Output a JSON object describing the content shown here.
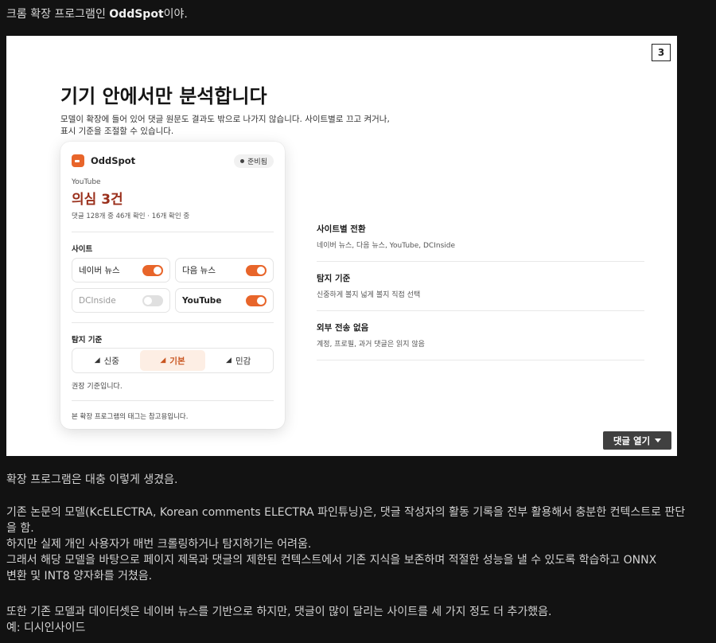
{
  "post": {
    "intro_before": "크롬 확장 프로그램인 ",
    "intro_bold": "OddSpot",
    "intro_after": "이야."
  },
  "slide": {
    "page_number": "3",
    "title": "기기 안에서만 분석합니다",
    "desc_line1": "모델이 확장에 들어 있어 댓글 원문도 결과도 밖으로 나가지 않습니다. 사이트별로 끄고 켜거나,",
    "desc_line2": "표시 기준을 조절할 수 있습니다.",
    "comment_button": "댓글 열기"
  },
  "card": {
    "brand": "OddSpot",
    "status": "준비됨",
    "site": "YouTube",
    "count": "의심 3건",
    "sub": "댓글 128개 중 46개 확인 · 16개 확인 중",
    "sites_label": "사이트",
    "sites": [
      {
        "label": "네이버 뉴스",
        "on": true
      },
      {
        "label": "다음 뉴스",
        "on": true
      },
      {
        "label": "DCInside",
        "on": false
      },
      {
        "label": "YouTube",
        "on": true
      }
    ],
    "criteria_label": "탐지 기준",
    "criteria": [
      {
        "label": "신중",
        "active": false
      },
      {
        "label": "기본",
        "active": true
      },
      {
        "label": "민감",
        "active": false
      }
    ],
    "hint": "권장 기준입니다.",
    "footer": "본 확장 프로그램의 태그는 참고용입니다."
  },
  "features": [
    {
      "title": "사이트별 전환",
      "desc": "네이버 뉴스, 다음 뉴스, YouTube, DCInside"
    },
    {
      "title": "탐지 기준",
      "desc": "신중하게 볼지 넓게 볼지 직접 선택"
    },
    {
      "title": "외부 전송 없음",
      "desc": "계정, 프로필, 과거 댓글은 읽지 않음"
    }
  ],
  "paragraphs": {
    "p1": "확장 프로그램은 대충 이렇게 생겼음.",
    "p2_l1": "기존 논문의 모델(KcELECTRA, Korean comments ELECTRA 파인튜닝)은, 댓글 작성자의 활동 기록을 전부 활용해서 충분한 컨텍스트로 판단",
    "p2_l2": "을 함.",
    "p2_l3": "하지만 실제 개인 사용자가 매번 크롤링하거나 탐지하기는 어려움.",
    "p2_l4": "그래서 해당 모델을 바탕으로 페이지 제목과 댓글의 제한된 컨텍스트에서 기존 지식을 보존하며 적절한 성능을 낼 수 있도록 학습하고 ONNX",
    "p2_l5": "변환 및 INT8 양자화를 거쳤음.",
    "p3_l1": "또한 기존 모델과 데이터셋은 네이버 뉴스를 기반으로 하지만, 댓글이 많이 달리는 사이트를 세 가지 정도 더 추가했음.",
    "p3_l2": "예: 디시인사이드"
  },
  "colors": {
    "accent": "#e8652a",
    "count_red": "#9a2f1b",
    "background": "#121212"
  }
}
